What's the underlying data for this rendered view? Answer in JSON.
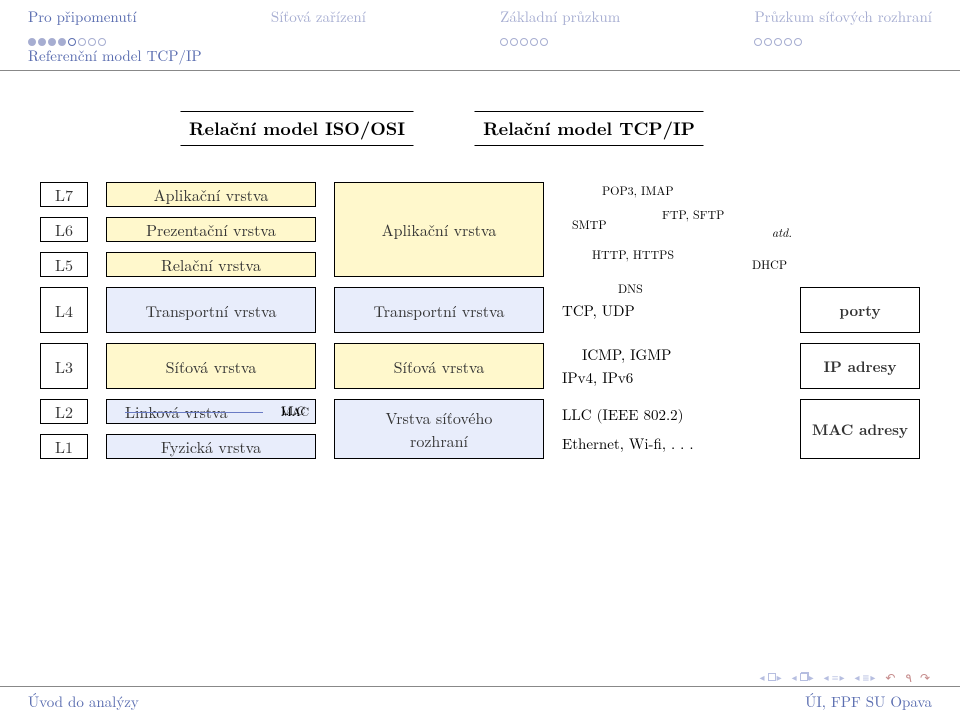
{
  "nav": {
    "sections": [
      {
        "label": "Pro připomenutí",
        "dim": false,
        "dots": 8,
        "filled": 4,
        "current": 5
      },
      {
        "label": "Síťová zařízení",
        "dim": true,
        "dots": 0,
        "filled": 0,
        "current": 0
      },
      {
        "label": "Základní průzkum",
        "dim": true,
        "dots": 5,
        "filled": 0,
        "current": 0
      },
      {
        "label": "Průzkum síťových rozhraní",
        "dim": true,
        "dots": 5,
        "filled": 0,
        "current": 0
      }
    ],
    "subsection": "Referenční model TCP/IP"
  },
  "titles": {
    "left": "Relační model ISO/OSI",
    "right": "Relační model TCP/IP"
  },
  "layers": {
    "L7": {
      "id": "L7",
      "osi": "Aplikační vrstva"
    },
    "L6": {
      "id": "L6",
      "osi": "Prezentační vrstva"
    },
    "L5": {
      "id": "L5",
      "osi": "Relační vrstva"
    },
    "L4": {
      "id": "L4",
      "osi": "Transportní vrstva"
    },
    "L3": {
      "id": "L3",
      "osi": "Síťová vrstva"
    },
    "L2": {
      "id": "L2",
      "osi": "Linková vrstva",
      "sub_upper": "LLC",
      "sub_lower": "MAC"
    },
    "L1": {
      "id": "L1",
      "osi": "Fyzická vrstva"
    }
  },
  "tcp": {
    "app": "Aplikační vrstva",
    "transport": "Transportní vrstva",
    "network": "Síťová vrstva",
    "nic": "Vrstva síťového\nrozhraní"
  },
  "examples": {
    "app": {
      "pop3": "POP3, IMAP",
      "smtp": "SMTP",
      "ftp": "FTP, SFTP",
      "http": "HTTP, HTTPS",
      "dns": "DNS",
      "etc": "atd.",
      "dhcp": "DHCP"
    },
    "transport": "TCP, UDP",
    "network_top": "ICMP, IGMP",
    "network_bot": "IPv4, IPv6",
    "link_top": "LLC (IEEE 802.2)",
    "link_bot": "Ethernet, Wi-fi, . . ."
  },
  "addresses": {
    "ports": "porty",
    "ip": "IP adresy",
    "mac": "MAC adresy"
  },
  "footer": {
    "left": "Úvod do analýzy",
    "right": "ÚI, FPF SU Opava"
  }
}
